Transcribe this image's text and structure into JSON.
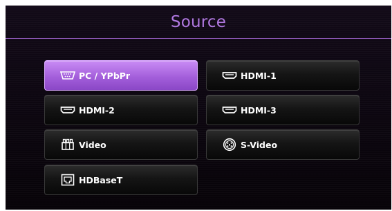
{
  "title": "Source",
  "sources": [
    {
      "label": "PC / YPbPr",
      "icon": "vga-port-icon",
      "selected": true
    },
    {
      "label": "HDMI-1",
      "icon": "hdmi-port-icon",
      "selected": false
    },
    {
      "label": "HDMI-2",
      "icon": "hdmi-port-icon",
      "selected": false
    },
    {
      "label": "HDMI-3",
      "icon": "hdmi-port-icon",
      "selected": false
    },
    {
      "label": "Video",
      "icon": "composite-video-icon",
      "selected": false
    },
    {
      "label": "S-Video",
      "icon": "s-video-port-icon",
      "selected": false
    },
    {
      "label": "HDBaseT",
      "icon": "hdbaset-port-icon",
      "selected": false
    }
  ],
  "colors": {
    "accent": "#b078e0",
    "selected_fill": "#a45fdb",
    "button_fill": "#151515",
    "background": "#0c0610"
  }
}
